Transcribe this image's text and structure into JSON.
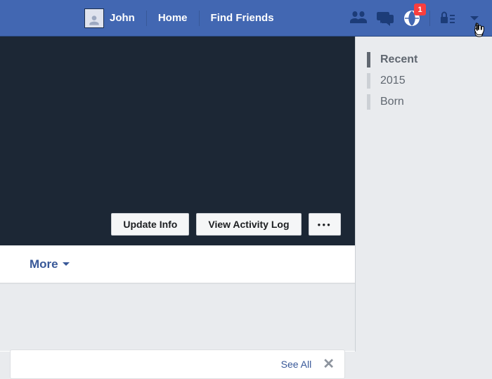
{
  "nav": {
    "user_name": "John",
    "home": "Home",
    "find_friends": "Find Friends",
    "notification_count": "1"
  },
  "cover": {
    "update_info": "Update Info",
    "activity_log": "View Activity Log",
    "overflow": "●●●"
  },
  "tabs": {
    "more": "More"
  },
  "lower": {
    "see_all": "See All"
  },
  "timeline": {
    "items": [
      {
        "label": "Recent",
        "active": true
      },
      {
        "label": "2015",
        "active": false
      },
      {
        "label": "Born",
        "active": false
      }
    ]
  }
}
